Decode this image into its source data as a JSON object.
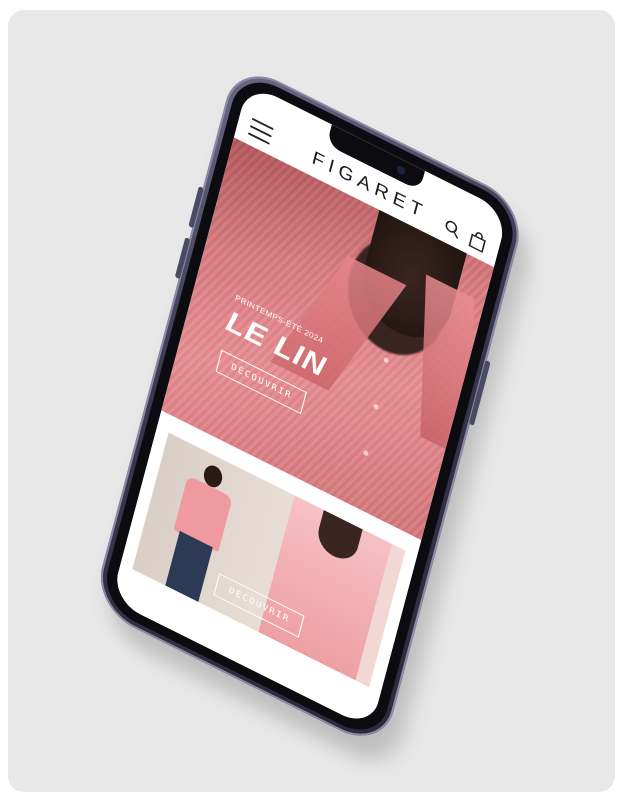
{
  "app": {
    "brand": "FIGARET"
  },
  "header": {
    "menu_icon": "hamburger-menu-icon",
    "search_icon": "search-icon",
    "bag_icon": "shopping-bag-icon"
  },
  "hero": {
    "eyebrow": "PRINTEMPS-ÉTÉ 2024",
    "headline": "LE LIN",
    "cta_label": "DÉCOUVRIR",
    "accent_color": "#e08a8f"
  },
  "banner2": {
    "cta_label": "DÉCOUVRIR"
  }
}
